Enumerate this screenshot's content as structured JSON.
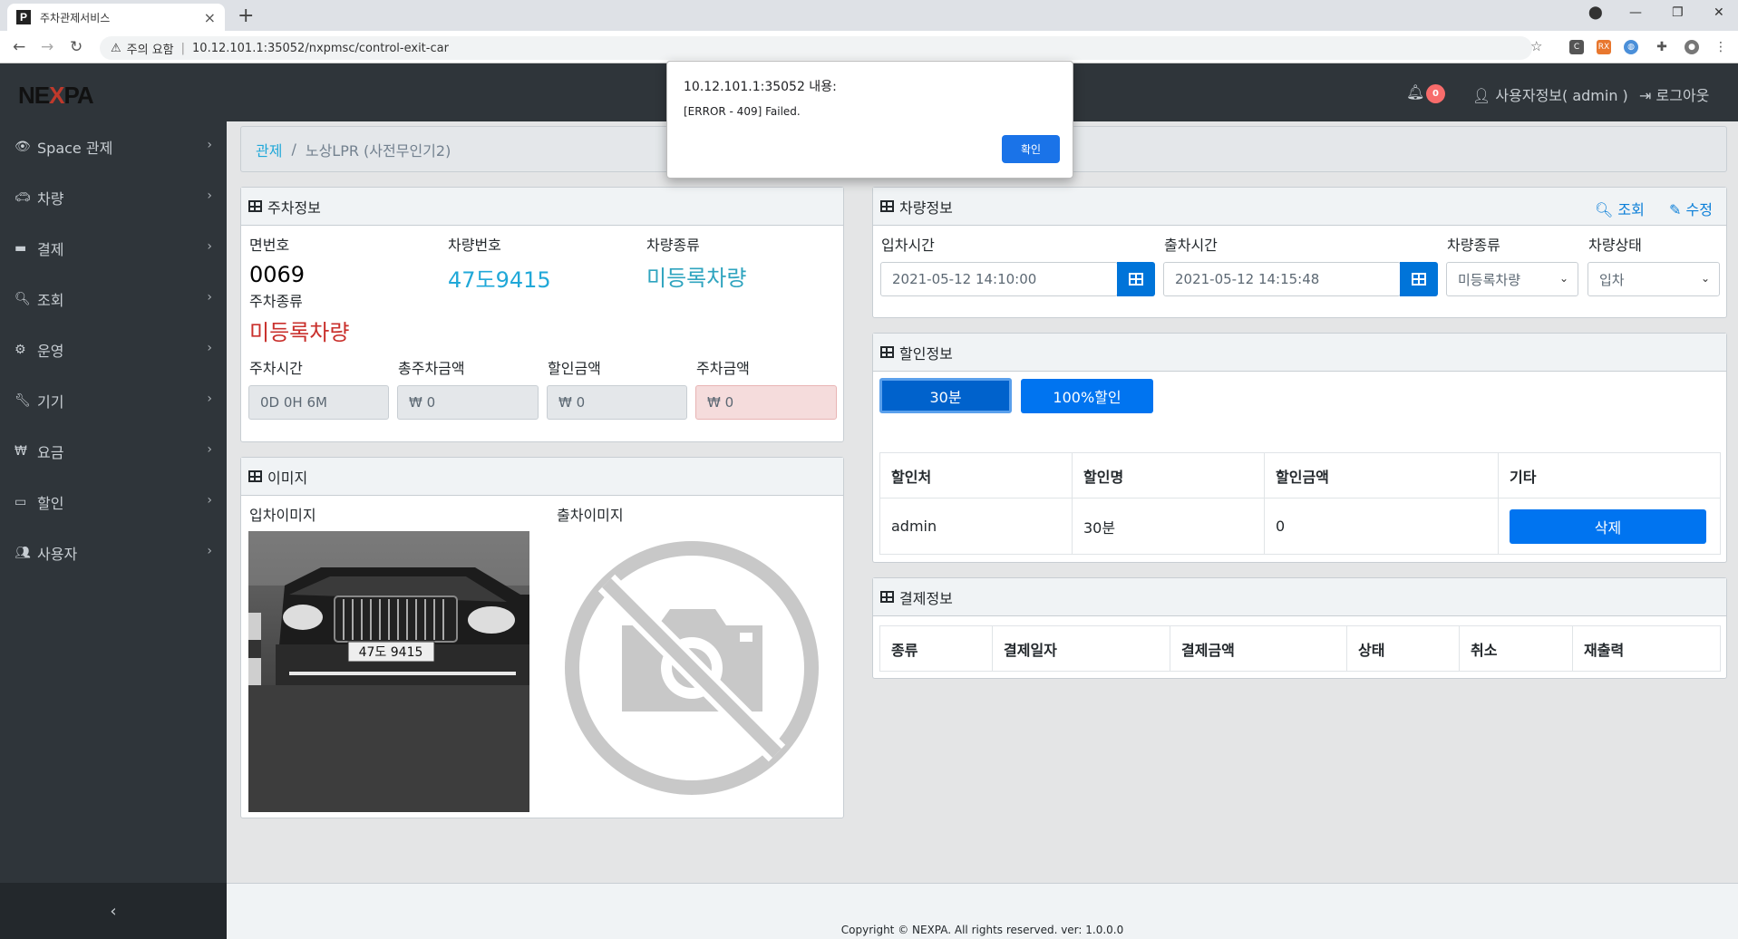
{
  "browser": {
    "tab_title": "주차관제서비스",
    "tab_favicon": "P",
    "url_warning": "주의 요함",
    "url": "10.12.101.1:35052/nxpmsc/control-exit-car"
  },
  "header": {
    "logo_part1": "NE",
    "logo_x": "X",
    "logo_part2": "PA",
    "notification_count": "0",
    "user_info": "사용자정보( admin )",
    "logout": "로그아웃"
  },
  "sidebar": {
    "items": [
      {
        "label": "Space 관제",
        "icon": "eye-icon"
      },
      {
        "label": "차량",
        "icon": "car-icon"
      },
      {
        "label": "결제",
        "icon": "credit-card-icon"
      },
      {
        "label": "조회",
        "icon": "search-icon"
      },
      {
        "label": "운영",
        "icon": "cogs-icon"
      },
      {
        "label": "기기",
        "icon": "wrench-icon"
      },
      {
        "label": "요금",
        "icon": "won-icon"
      },
      {
        "label": "할인",
        "icon": "ticket-icon"
      },
      {
        "label": "사용자",
        "icon": "users-icon"
      }
    ]
  },
  "breadcrumb": {
    "root": "관제",
    "current": "노상LPR (사전무인기2)"
  },
  "parking_info": {
    "title": "주차정보",
    "space_no_label": "면번호",
    "space_no": "0069",
    "car_no_label": "차량번호",
    "car_no": "47도9415",
    "car_type_label": "차량종류",
    "car_type": "미등록차량",
    "parking_type_label": "주차종류",
    "parking_type": "미등록차량",
    "duration_label": "주차시간",
    "duration": "0D 0H 6M",
    "total_label": "총주차금액",
    "total": "₩ 0",
    "discount_label": "할인금액",
    "discount": "₩ 0",
    "fee_label": "주차금액",
    "fee": "₩ 0"
  },
  "image_card": {
    "title": "이미지",
    "entry_label": "입차이미지",
    "exit_label": "출차이미지",
    "plate_text": "47도 9415"
  },
  "vehicle_info": {
    "title": "차량정보",
    "search": "조회",
    "edit": "수정",
    "entry_time_label": "입차시간",
    "entry_time": "2021-05-12 14:10:00",
    "exit_time_label": "출차시간",
    "exit_time": "2021-05-12 14:15:48",
    "car_type_label": "차량종류",
    "car_type": "미등록차량",
    "car_status_label": "차량상태",
    "car_status": "입차"
  },
  "discount_info": {
    "title": "할인정보",
    "btn_30": "30분",
    "btn_100": "100%할인",
    "columns": [
      "할인처",
      "할인명",
      "할인금액",
      "기타"
    ],
    "rows": [
      {
        "org": "admin",
        "name": "30분",
        "amount": "0",
        "action": "삭제"
      }
    ]
  },
  "payment_info": {
    "title": "결제정보",
    "columns": [
      "종류",
      "결제일자",
      "결제금액",
      "상태",
      "취소",
      "재출력"
    ]
  },
  "footer": {
    "copyright": "Copyright © NEXPA. All rights reserved. ver: 1.0.0.0"
  },
  "dialog": {
    "title": "10.12.101.1:35052 내용:",
    "message": "[ERROR - 409] Failed.",
    "ok": "확인"
  },
  "colors": {
    "sidebar_bg": "#2f353a",
    "primary": "#0074f0",
    "link": "#20a8d8",
    "danger": "#d9534f"
  }
}
